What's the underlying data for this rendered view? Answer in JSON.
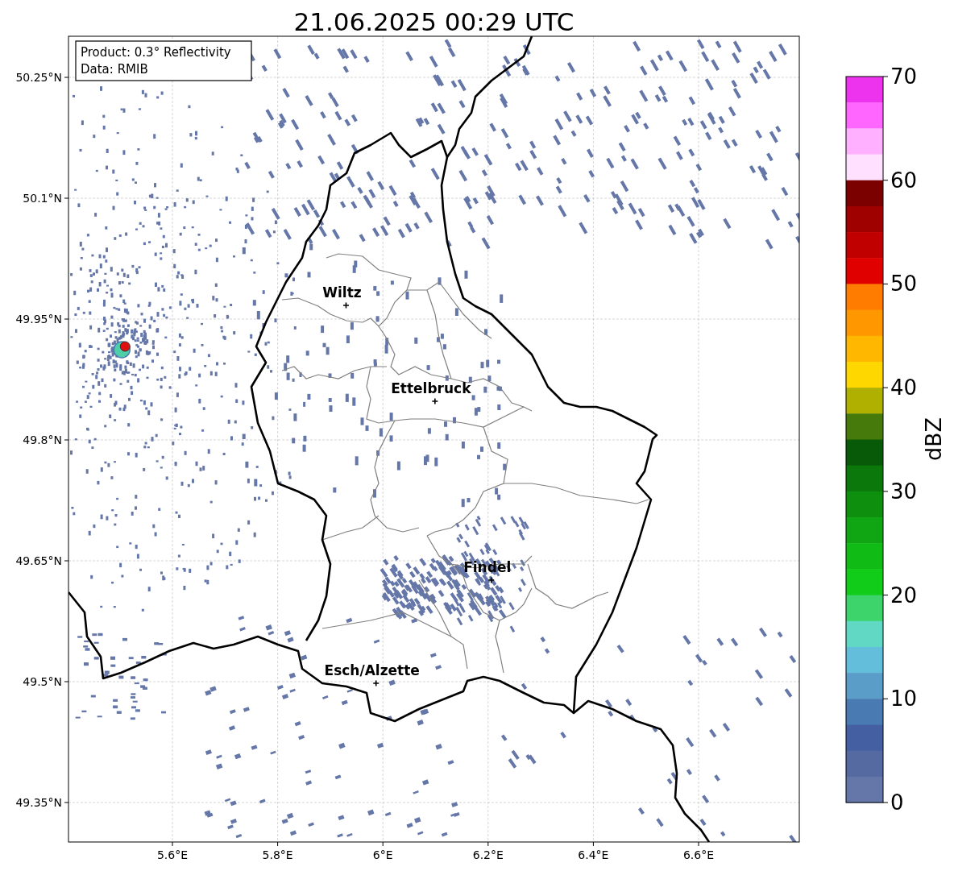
{
  "title": "21.06.2025 00:29 UTC",
  "info_box": [
    "Product: 0.3° Reflectivity",
    "Data: RMIB"
  ],
  "map": {
    "yticks": [
      "50.25°N",
      "50.1°N",
      "49.95°N",
      "49.8°N",
      "49.65°N",
      "49.5°N",
      "49.35°N"
    ],
    "xticks": [
      "5.6°E",
      "5.8°E",
      "6°E",
      "6.2°E",
      "6.4°E",
      "6.6°E"
    ],
    "cities": [
      "Wiltz",
      "Ettelbruck",
      "Findel",
      "Esch/Alzette"
    ]
  },
  "colorbar": {
    "label": "dBZ",
    "ticks": [
      "70",
      "60",
      "50",
      "40",
      "30",
      "20",
      "10",
      "0"
    ],
    "segments": [
      {
        "color": "#ee33ee"
      },
      {
        "color": "#ff66ff"
      },
      {
        "color": "#ffb0ff"
      },
      {
        "color": "#ffe0ff"
      },
      {
        "color": "#7b0000"
      },
      {
        "color": "#9f0000"
      },
      {
        "color": "#c00000"
      },
      {
        "color": "#e10000"
      },
      {
        "color": "#ff7c00"
      },
      {
        "color": "#ff9800"
      },
      {
        "color": "#ffb700"
      },
      {
        "color": "#ffd700"
      },
      {
        "color": "#b0b000"
      },
      {
        "color": "#467a0a"
      },
      {
        "color": "#085a08"
      },
      {
        "color": "#0b780b"
      },
      {
        "color": "#0e900e"
      },
      {
        "color": "#10a512"
      },
      {
        "color": "#10bb16"
      },
      {
        "color": "#12cc1a"
      },
      {
        "color": "#3dd46c"
      },
      {
        "color": "#60d8c4"
      },
      {
        "color": "#62bedb"
      },
      {
        "color": "#5a9dc8"
      },
      {
        "color": "#4a7ab2"
      },
      {
        "color": "#4460a3"
      },
      {
        "color": "#556aa0"
      },
      {
        "color": "#6577a8"
      }
    ]
  }
}
